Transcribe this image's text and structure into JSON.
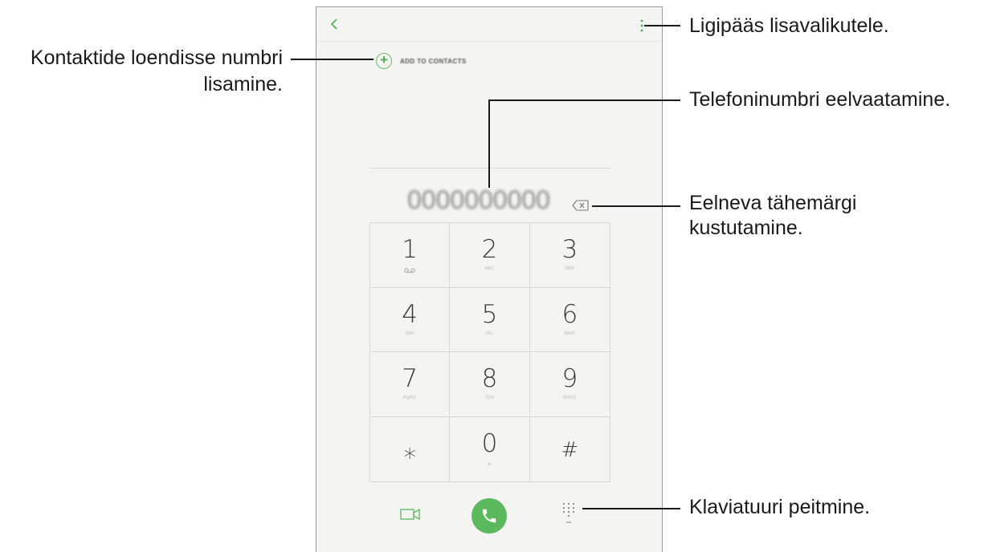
{
  "phone": {
    "add_to_contacts_label": "ADD TO CONTACTS",
    "number_preview": "0000000000",
    "keys": [
      {
        "digit": "1",
        "letters": ""
      },
      {
        "digit": "2",
        "letters": "ABC"
      },
      {
        "digit": "3",
        "letters": "DEF"
      },
      {
        "digit": "4",
        "letters": "GHI"
      },
      {
        "digit": "5",
        "letters": "JKL"
      },
      {
        "digit": "6",
        "letters": "MNO"
      },
      {
        "digit": "7",
        "letters": "PQRS"
      },
      {
        "digit": "8",
        "letters": "TUV"
      },
      {
        "digit": "9",
        "letters": "WXYZ"
      },
      {
        "digit": "⁎",
        "letters": ""
      },
      {
        "digit": "0",
        "letters": "+"
      },
      {
        "digit": "#",
        "letters": ""
      }
    ],
    "accent_color": "#5cb85c"
  },
  "callouts": {
    "more_options": "Ligipääs lisavalikutele.",
    "add_contact_line1": "Kontaktide loendisse numbri",
    "add_contact_line2": "lisamine.",
    "preview_number": "Telefoninumbri eelvaatamine.",
    "delete_line1": "Eelneva tähemärgi",
    "delete_line2": "kustutamine.",
    "hide_keypad": "Klaviatuuri peitmine."
  }
}
